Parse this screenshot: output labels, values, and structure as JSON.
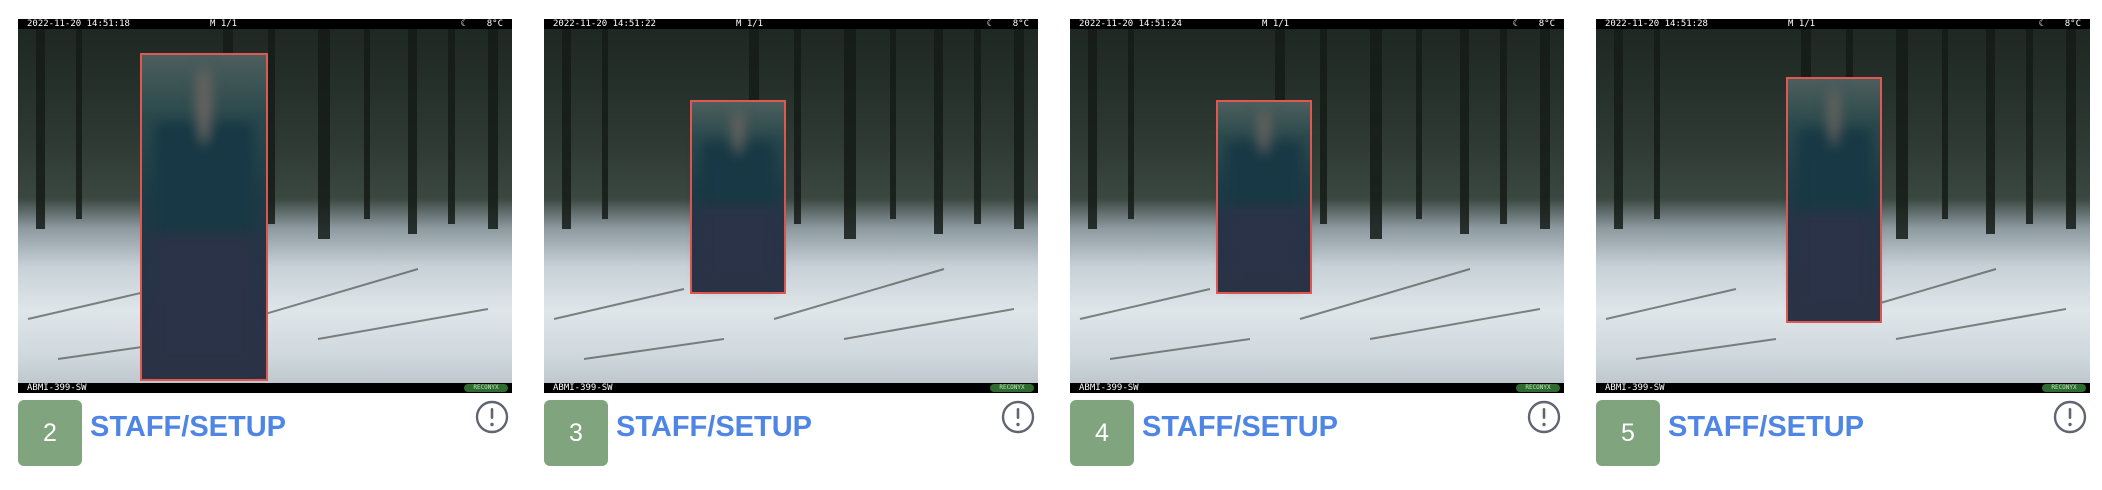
{
  "colors": {
    "index_badge": "#80a47d",
    "label": "#4f86e6",
    "bounding_box": "#e0584f",
    "alert_icon": "#5f6670"
  },
  "cards": [
    {
      "index": "2",
      "label": "STAFF/SETUP",
      "timestamp": "2022-11-20 14:51:18",
      "sequence": "M 1/1",
      "moon": "☾",
      "temperature": "8°C",
      "camera_id": "ABMI-399-SW",
      "brand": "RECONYX",
      "icon": "alert-circle-icon"
    },
    {
      "index": "3",
      "label": "STAFF/SETUP",
      "timestamp": "2022-11-20 14:51:22",
      "sequence": "M 1/1",
      "moon": "☾",
      "temperature": "8°C",
      "camera_id": "ABMI-399-SW",
      "brand": "RECONYX",
      "icon": "alert-circle-icon"
    },
    {
      "index": "4",
      "label": "STAFF/SETUP",
      "timestamp": "2022-11-20 14:51:24",
      "sequence": "M 1/1",
      "moon": "☾",
      "temperature": "8°C",
      "camera_id": "ABMI-399-SW",
      "brand": "RECONYX",
      "icon": "alert-circle-icon"
    },
    {
      "index": "5",
      "label": "STAFF/SETUP",
      "timestamp": "2022-11-20 14:51:28",
      "sequence": "M 1/1",
      "moon": "☾",
      "temperature": "8°C",
      "camera_id": "ABMI-399-SW",
      "brand": "RECONYX",
      "icon": "alert-circle-icon"
    }
  ]
}
